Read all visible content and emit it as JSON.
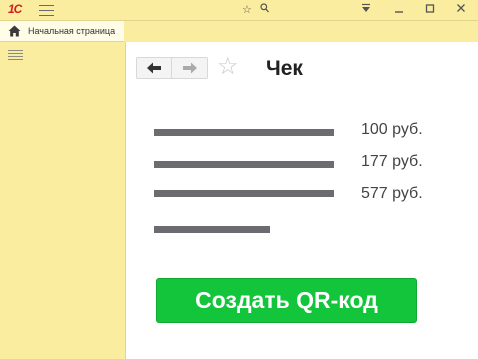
{
  "app": {
    "logo_text": "1С",
    "logo_color": "#d31e1e"
  },
  "titlebar": {
    "icons": [
      "star-icon",
      "search-icon",
      "menu-toggle-icon",
      "minimize-icon",
      "maximize-icon",
      "close-icon"
    ]
  },
  "sidebar": {
    "home_label": "Начальная страница"
  },
  "document": {
    "title": "Чек",
    "lines": [
      {
        "price": "100 руб."
      },
      {
        "price": "177 руб."
      },
      {
        "price": "577 руб."
      }
    ],
    "total_line_price": ""
  },
  "actions": {
    "create_qr_label": "Создать QR-код"
  },
  "colors": {
    "panel_bg": "#fbeda0",
    "button_green": "#12c53b",
    "bar_gray": "#6c6c70"
  }
}
